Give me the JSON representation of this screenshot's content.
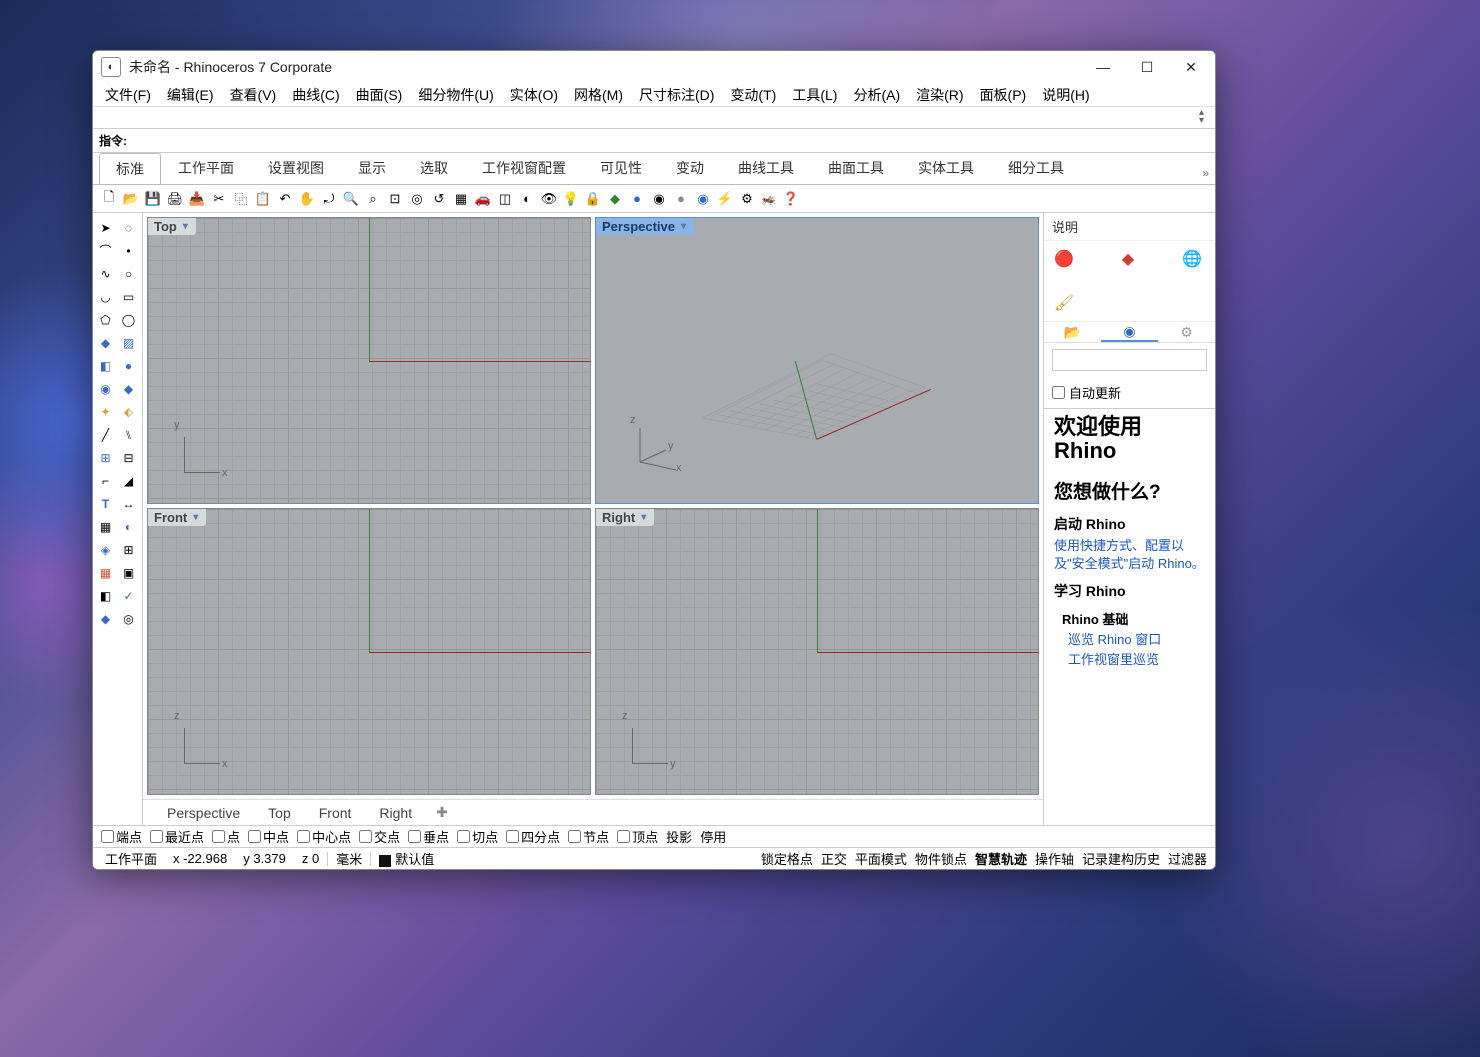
{
  "window": {
    "title": "未命名 - Rhinoceros 7 Corporate"
  },
  "menus": [
    "文件(F)",
    "编辑(E)",
    "查看(V)",
    "曲线(C)",
    "曲面(S)",
    "细分物件(U)",
    "实体(O)",
    "网格(M)",
    "尺寸标注(D)",
    "变动(T)",
    "工具(L)",
    "分析(A)",
    "渲染(R)",
    "面板(P)",
    "说明(H)"
  ],
  "command_label": "指令:",
  "tool_tabs": {
    "active": "标准",
    "items": [
      "标准",
      "工作平面",
      "设置视图",
      "显示",
      "选取",
      "工作视窗配置",
      "可见性",
      "变动",
      "曲线工具",
      "曲面工具",
      "实体工具",
      "细分工具"
    ],
    "overflow": "»"
  },
  "viewports": {
    "top": "Top",
    "perspective": "Perspective",
    "front": "Front",
    "right": "Right"
  },
  "axes": {
    "x": "x",
    "y": "y",
    "z": "z"
  },
  "viewport_tabs": [
    "Perspective",
    "Top",
    "Front",
    "Right"
  ],
  "right_panel": {
    "title": "说明",
    "auto_update": "自动更新",
    "help": {
      "h1": "欢迎使用 Rhino",
      "h2": "您想做什么?",
      "h3a": "启动 Rhino",
      "link1": "使用快捷方式、配置以及\"安全模式\"启动 Rhino。",
      "h3b": "学习 Rhino",
      "h4": "Rhino 基础",
      "link2": "巡览 Rhino 窗口",
      "link3": "工作视窗里巡览"
    }
  },
  "osnaps": [
    "端点",
    "最近点",
    "点",
    "中点",
    "中心点",
    "交点",
    "垂点",
    "切点",
    "四分点",
    "节点",
    "顶点",
    "投影",
    "停用"
  ],
  "status": {
    "cplane": "工作平面",
    "x": "x -22.968",
    "y": "y 3.379",
    "z": "z 0",
    "units": "毫米",
    "layer": "默认值",
    "toggles": [
      "锁定格点",
      "正交",
      "平面模式",
      "物件锁点",
      "智慧轨迹",
      "操作轴",
      "记录建构历史",
      "过滤器"
    ],
    "bold_toggle": "智慧轨迹"
  }
}
